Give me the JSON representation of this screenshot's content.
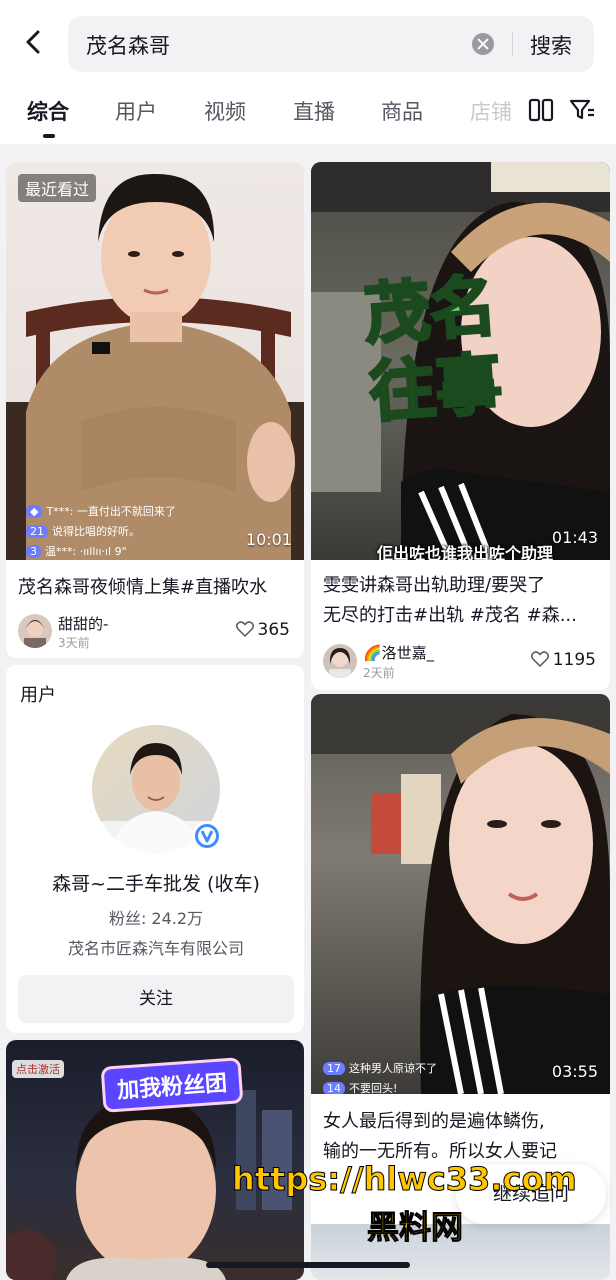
{
  "search": {
    "query": "茂名森哥",
    "button_label": "搜索"
  },
  "tabs": [
    "综合",
    "用户",
    "视频",
    "直播",
    "商品",
    "店铺"
  ],
  "icons": {
    "back": "chevron-left-icon",
    "clear": "clear-circle-icon",
    "layout": "double-column-icon",
    "filter": "filter-icon",
    "like": "heart-icon",
    "verified": "verified-v-icon"
  },
  "cards": [
    {
      "badge": "最近看过",
      "duration": "10:01",
      "title": "茂名森哥夜倾情上集#直播吹水",
      "author": "甜甜的-",
      "time_ago": "3天前",
      "likes": "365",
      "comments": [
        "T***: 一直付出不就回来了",
        "说得比唱的好听。",
        "温***: ·ııllıı·ıl 9\""
      ],
      "comment_levels": [
        "",
        "21",
        "3"
      ]
    },
    {
      "cover_text_1": "茂名",
      "cover_text_2": "往事",
      "subtitle": "佢出咗也谁我出咗个助理",
      "duration": "01:43",
      "title_line1": "雯雯讲森哥出轨助理/要哭了",
      "title_line2": "无尽的打击#出轨 #茂名 #森...",
      "author": "🌈洛世嘉_",
      "time_ago": "2天前",
      "likes": "1195"
    },
    {
      "duration": "03:55",
      "title_line1": "女人最后得到的是遍体鳞伤,",
      "title_line2": "输的一无所有。所以女人要记",
      "comments": [
        "这种男人原谅不了",
        "不要回头!"
      ],
      "comment_levels": [
        "17",
        "14"
      ]
    },
    {
      "badge": "点击激活",
      "banner": "加我粉丝团"
    }
  ],
  "user_card": {
    "label": "用户",
    "name": "森哥~二手车批发 (收车)",
    "fans": "粉丝: 24.2万",
    "company": "茂名市匠森汽车有限公司",
    "follow_label": "关注"
  },
  "continue_button": "继续追问",
  "watermark": {
    "line1": "https://hlwc33.com",
    "line2": "黑料网"
  },
  "colors": {
    "accent_blue": "#3f8cff",
    "banner_purple": "#5a46ff",
    "watermark_yellow": "#ffc600"
  }
}
